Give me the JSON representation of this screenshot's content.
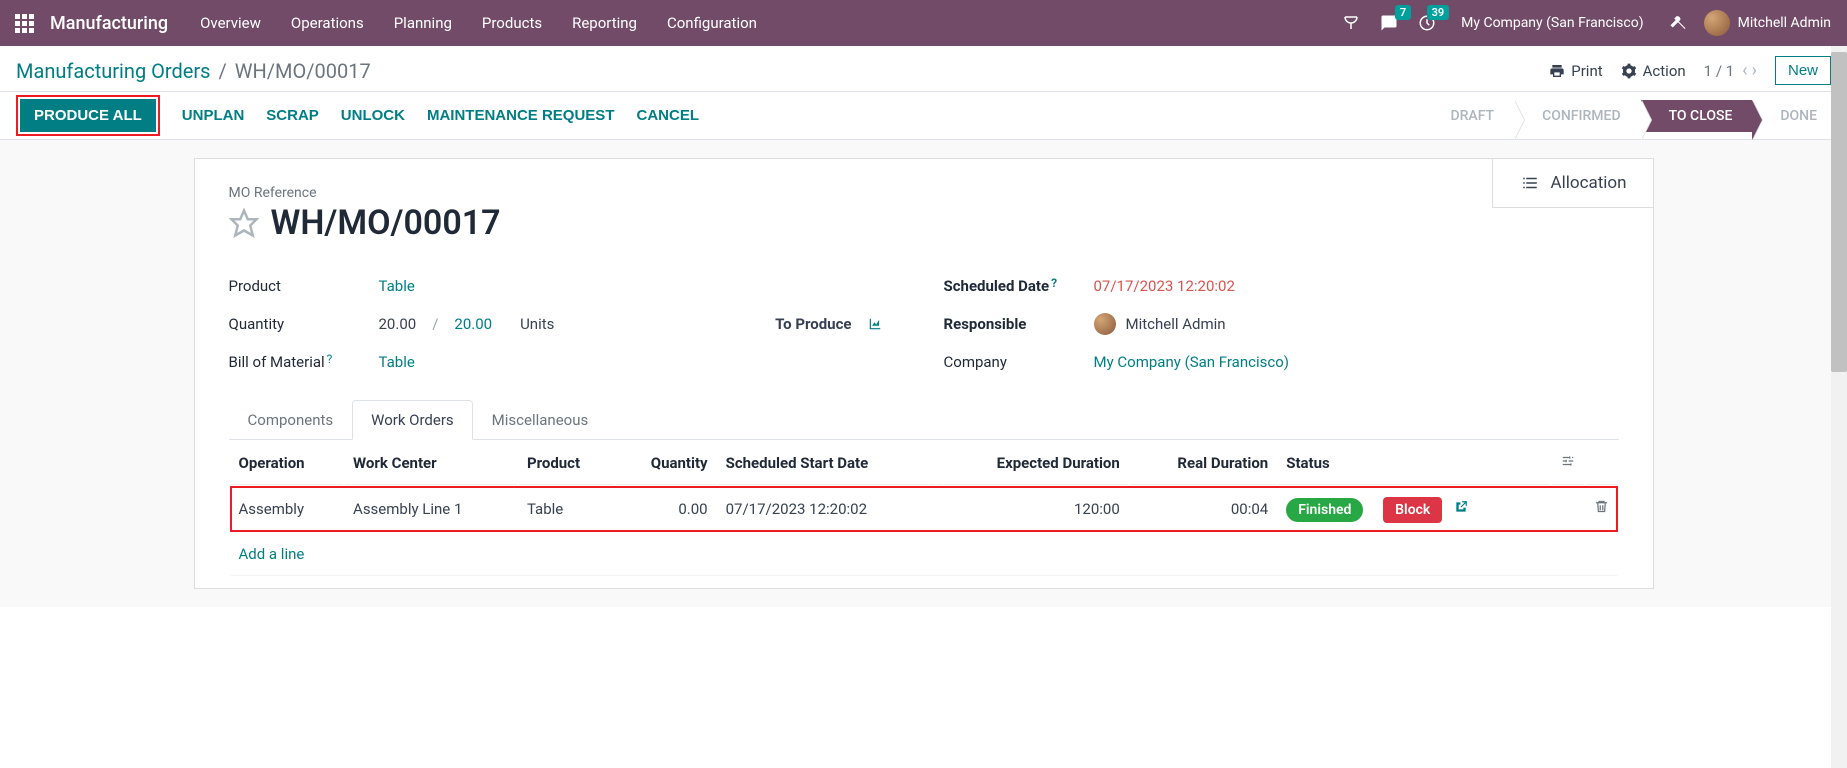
{
  "navbar": {
    "brand": "Manufacturing",
    "items": [
      "Overview",
      "Operations",
      "Planning",
      "Products",
      "Reporting",
      "Configuration"
    ],
    "messages_badge": "7",
    "activities_badge": "39",
    "company": "My Company (San Francisco)",
    "user": "Mitchell Admin"
  },
  "breadcrumb": {
    "root": "Manufacturing Orders",
    "current": "WH/MO/00017"
  },
  "cp": {
    "print": "Print",
    "action": "Action",
    "pager": "1 / 1",
    "new": "New"
  },
  "statusbar": {
    "produce_all": "PRODUCE ALL",
    "unplan": "UNPLAN",
    "scrap": "SCRAP",
    "unlock": "UNLOCK",
    "maintenance": "MAINTENANCE REQUEST",
    "cancel": "CANCEL",
    "stages": {
      "draft": "DRAFT",
      "confirmed": "CONFIRMED",
      "to_close": "TO CLOSE",
      "done": "DONE"
    }
  },
  "buttonbox": {
    "allocation": "Allocation"
  },
  "title": {
    "label": "MO Reference",
    "name": "WH/MO/00017"
  },
  "fields_left": {
    "product_label": "Product",
    "product_value": "Table",
    "quantity_label": "Quantity",
    "qty_done": "20.00",
    "qty_total": "20.00",
    "uom": "Units",
    "to_produce": "To Produce",
    "bom_label": "Bill of Material",
    "bom_value": "Table"
  },
  "fields_right": {
    "scheduled_label": "Scheduled Date",
    "scheduled_value": "07/17/2023 12:20:02",
    "responsible_label": "Responsible",
    "responsible_value": "Mitchell Admin",
    "company_label": "Company",
    "company_value": "My Company (San Francisco)"
  },
  "tabs": {
    "components": "Components",
    "work_orders": "Work Orders",
    "miscellaneous": "Miscellaneous"
  },
  "wo_table": {
    "headers": {
      "operation": "Operation",
      "work_center": "Work Center",
      "product": "Product",
      "quantity": "Quantity",
      "scheduled": "Scheduled Start Date",
      "expected": "Expected Duration",
      "real": "Real Duration",
      "status": "Status"
    },
    "rows": [
      {
        "operation": "Assembly",
        "work_center": "Assembly Line 1",
        "product": "Table",
        "quantity": "0.00",
        "scheduled": "07/17/2023 12:20:02",
        "expected": "120:00",
        "real": "00:04",
        "status": "Finished",
        "block": "Block"
      }
    ],
    "add_line": "Add a line"
  }
}
